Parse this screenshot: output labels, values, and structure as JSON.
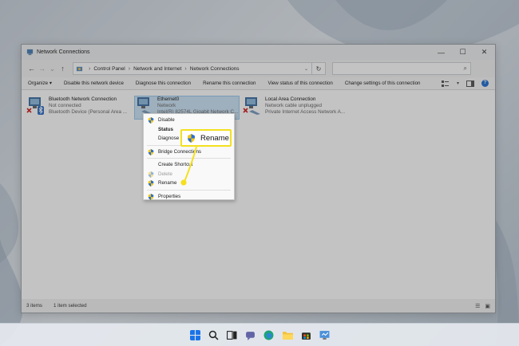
{
  "window": {
    "title": "Network Connections",
    "controls": {
      "minimize": "—",
      "maximize": "☐",
      "close": "✕"
    }
  },
  "address_bar": {
    "back": "←",
    "forward": "→",
    "recent": "⌄",
    "up": "↑",
    "crumbs": [
      "Control Panel",
      "Network and Internet",
      "Network Connections"
    ],
    "separator": "›",
    "dropdown": "⌄",
    "refresh": "↻",
    "search_icon": "⌕"
  },
  "toolbar": {
    "items": [
      "Organize ▾",
      "Disable this network device",
      "Diagnose this connection",
      "Rename this connection",
      "View status of this connection",
      "Change settings of this connection"
    ],
    "view_dropdown": "▾",
    "help": "?"
  },
  "connections": [
    {
      "name": "Bluetooth Network Connection",
      "status": "Not connected",
      "device": "Bluetooth Device (Personal Area ..."
    },
    {
      "name": "Ethernet0",
      "status": "Network",
      "device": "Intel(R) 82574L Gigabit Network C..."
    },
    {
      "name": "Local Area Connection",
      "status": "Network cable unplugged",
      "device": "Private Internet Access Network A..."
    }
  ],
  "context_menu": {
    "disable": "Disable",
    "status": "Status",
    "diagnose": "Diagnose",
    "bridge": "Bridge Connections",
    "shortcut": "Create Shortcut",
    "delete": "Delete",
    "rename": "Rename",
    "properties": "Properties"
  },
  "callout": {
    "label": "Rename",
    "color": "#f4e01e"
  },
  "status_bar": {
    "items_count": "3 items",
    "selected": "1 item selected"
  },
  "taskbar_icons": [
    "windows-start-icon",
    "search-icon",
    "task-view-icon",
    "chat-icon",
    "edge-browser-icon",
    "file-explorer-icon",
    "store-icon",
    "control-panel-icon"
  ]
}
